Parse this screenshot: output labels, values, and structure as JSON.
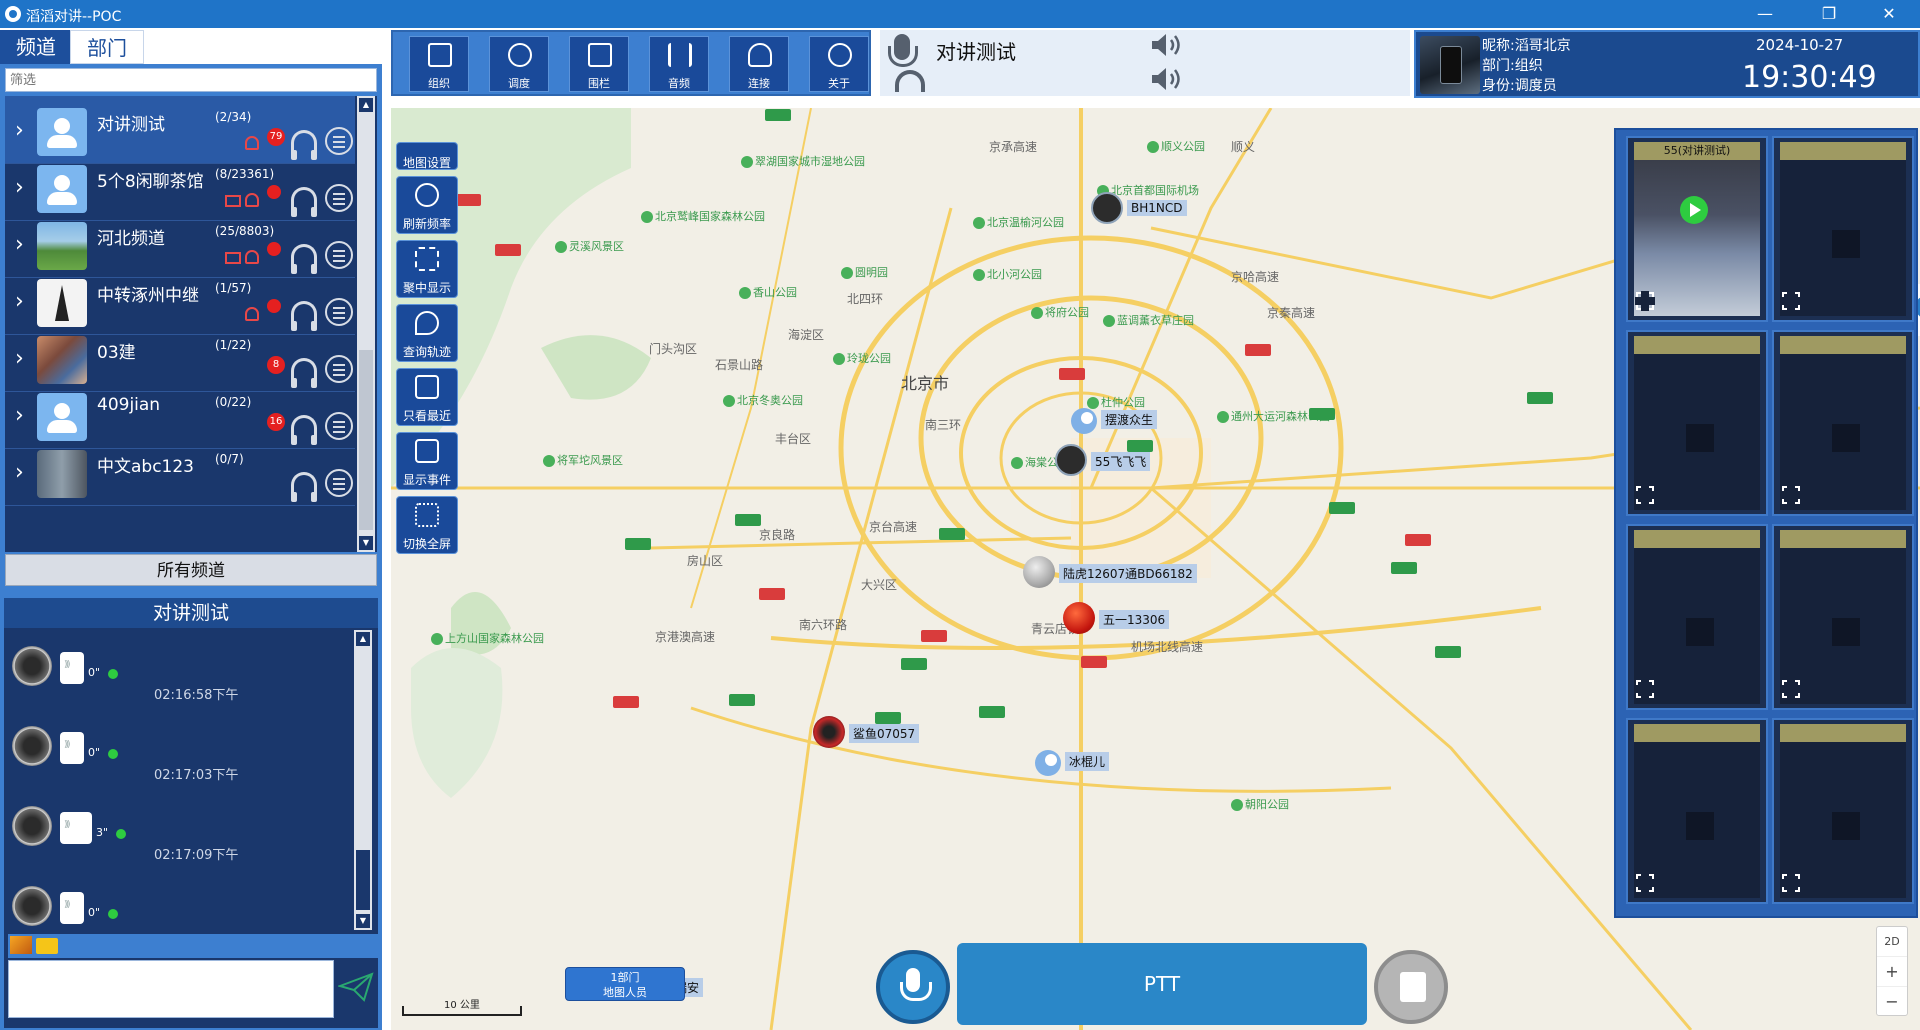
{
  "window": {
    "title": "滔滔对讲--POC",
    "minimize": "—",
    "maximize": "❐",
    "close": "✕"
  },
  "left_tabs": {
    "channel": "频道",
    "department": "部门"
  },
  "filter_placeholder": "筛选",
  "channels": [
    {
      "name": "对讲测试",
      "count": "(2/34)",
      "badge": "79",
      "avatar": "people"
    },
    {
      "name": "5个8闲聊茶馆",
      "count": "(8/23361)",
      "badge": "",
      "avatar": "people"
    },
    {
      "name": "河北频道",
      "count": "(25/8803)",
      "badge": "",
      "avatar": "landscape"
    },
    {
      "name": "中转涿州中继",
      "count": "(1/57)",
      "badge": "",
      "avatar": "tower"
    },
    {
      "name": "03建",
      "count": "(1/22)",
      "badge": "8",
      "avatar": "photo"
    },
    {
      "name": "409jian",
      "count": "(0/22)",
      "badge": "16",
      "avatar": "people"
    },
    {
      "name": "中文abc123",
      "count": "(0/7)",
      "badge": "",
      "avatar": "photo2"
    }
  ],
  "all_channels_label": "所有频道",
  "chat": {
    "title": "对讲测试",
    "messages": [
      {
        "duration": "0\"",
        "time": ""
      },
      {
        "duration": "0\"",
        "time": "02:16:58下午"
      },
      {
        "duration": "3\"",
        "time": "02:17:03下午"
      },
      {
        "duration": "0\"",
        "time": "02:17:09下午"
      }
    ],
    "input_value": ""
  },
  "toolbar": [
    {
      "label": "组织",
      "icon": "org-icon"
    },
    {
      "label": "调度",
      "icon": "dispatch-icon"
    },
    {
      "label": "围栏",
      "icon": "fence-icon"
    },
    {
      "label": "音频",
      "icon": "audio-icon"
    },
    {
      "label": "连接",
      "icon": "cloud-connect-icon"
    },
    {
      "label": "关于",
      "icon": "info-icon"
    }
  ],
  "talk": {
    "channel_name": "对讲测试"
  },
  "user": {
    "nickname": "昵称:滔哥北京",
    "department": "部门:组织",
    "identity": "身份:调度员",
    "date": "2024-10-27",
    "time": "19:30:49"
  },
  "map_tools": [
    {
      "label": "地图设置"
    },
    {
      "label": "刷新频率"
    },
    {
      "label": "聚中显示"
    },
    {
      "label": "查询轨迹"
    },
    {
      "label": "只看最近"
    },
    {
      "label": "显示事件"
    },
    {
      "label": "切换全屏"
    }
  ],
  "map_places": [
    {
      "text": "北京市"
    },
    {
      "text": "海淀区"
    },
    {
      "text": "门头沟区"
    },
    {
      "text": "丰台区"
    },
    {
      "text": "房山区"
    },
    {
      "text": "大兴区"
    },
    {
      "text": "北四环"
    },
    {
      "text": "南三环"
    },
    {
      "text": "南六环路"
    },
    {
      "text": "京良路"
    },
    {
      "text": "石景山路"
    },
    {
      "text": "京港澳高速"
    },
    {
      "text": "京哈高速"
    },
    {
      "text": "京承高速"
    },
    {
      "text": "京秦高速"
    },
    {
      "text": "青云店镇"
    },
    {
      "text": "京台高速"
    },
    {
      "text": "机场北线高速"
    },
    {
      "text": "顺义"
    }
  ],
  "map_parks": [
    {
      "text": "翠湖国家城市湿地公园"
    },
    {
      "text": "北京鹫峰国家森林公园"
    },
    {
      "text": "灵溪风景区"
    },
    {
      "text": "香山公园"
    },
    {
      "text": "圆明园"
    },
    {
      "text": "北京温榆河公园"
    },
    {
      "text": "北小河公园"
    },
    {
      "text": "将府公园"
    },
    {
      "text": "蓝调薰衣草庄园"
    },
    {
      "text": "玲珑公园"
    },
    {
      "text": "北京冬奥公园"
    },
    {
      "text": "杜仲公园"
    },
    {
      "text": "通州大运河森林公园"
    },
    {
      "text": "将军坨风景区"
    },
    {
      "text": "海棠公园"
    },
    {
      "text": "上方山国家森林公园"
    },
    {
      "text": "朝阳公园"
    },
    {
      "text": "顺义公园"
    },
    {
      "text": "北京首都国际机场"
    }
  ],
  "markers": [
    {
      "label": "BH1NCD",
      "type": "radio"
    },
    {
      "label": "摆渡众生",
      "type": "person"
    },
    {
      "label": "55飞飞飞",
      "type": "radio"
    },
    {
      "label": "陆虎12607通BD66182",
      "type": "moon"
    },
    {
      "label": "五一13306",
      "type": "ball"
    },
    {
      "label": "鲨鱼07057",
      "type": "red"
    },
    {
      "label": "冰棍儿",
      "type": "person"
    },
    {
      "label": "帮瑞安",
      "type": "person"
    }
  ],
  "scale_label": "10 公里",
  "dept_label": {
    "line1": "1部门",
    "line2": "地图人员"
  },
  "ptt_label": "PTT",
  "map_mode": "2D",
  "zoom_in": "+",
  "zoom_out": "−",
  "video_cells": [
    {
      "title": "55(对讲测试)",
      "live": true
    },
    {
      "title": "",
      "live": false
    },
    {
      "title": "",
      "live": false
    },
    {
      "title": "",
      "live": false
    },
    {
      "title": "",
      "live": false
    },
    {
      "title": "",
      "live": false
    },
    {
      "title": "",
      "live": false
    },
    {
      "title": "",
      "live": false
    }
  ],
  "colors": {
    "accent": "#1f74c8",
    "panel": "#1a376c",
    "badge": "#e52020",
    "ok": "#2ecc40"
  }
}
